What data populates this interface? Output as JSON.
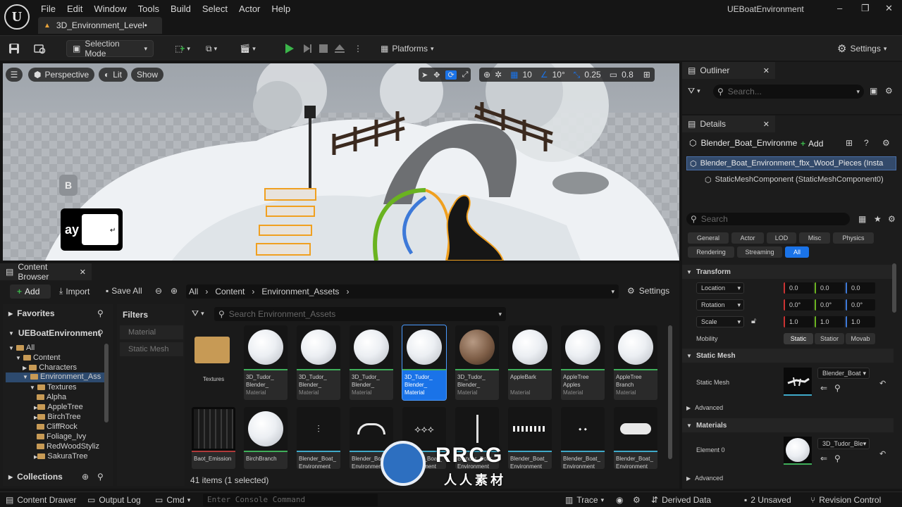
{
  "app_title": "UEBoatEnvironment",
  "menu": [
    "File",
    "Edit",
    "Window",
    "Tools",
    "Build",
    "Select",
    "Actor",
    "Help"
  ],
  "level_tab": "3D_Environment_Level•",
  "toolbar": {
    "selection_mode": "Selection Mode",
    "platforms": "Platforms",
    "settings": "Settings"
  },
  "viewport": {
    "perspective": "Perspective",
    "lit": "Lit",
    "show": "Show",
    "grid_snap": "10",
    "rot_snap": "10°",
    "scale_snap": "0.25",
    "cam_speed": "0.8",
    "key_b": "B",
    "key_text": "ay"
  },
  "outliner": {
    "title": "Outliner",
    "search_placeholder": "Search..."
  },
  "details": {
    "title": "Details",
    "actor_name": "Blender_Boat_Environme",
    "add_label": "Add",
    "selected_row": "Blender_Boat_Environment_fbx_Wood_Pieces (Insta",
    "component_row": "StaticMeshComponent (StaticMeshComponent0)",
    "search_placeholder": "Search",
    "categories": [
      "General",
      "Actor",
      "LOD",
      "Misc",
      "Physics",
      "Rendering",
      "Streaming",
      "All"
    ],
    "transform_section": "Transform",
    "location": {
      "label": "Location",
      "x": "0.0",
      "y": "0.0",
      "z": "0.0"
    },
    "rotation": {
      "label": "Rotation",
      "x": "0.0°",
      "y": "0.0°",
      "z": "0.0°"
    },
    "scale": {
      "label": "Scale",
      "x": "1.0",
      "y": "1.0",
      "z": "1.0"
    },
    "mobility": {
      "label": "Mobility",
      "options": [
        "Static",
        "Statior",
        "Movab"
      ]
    },
    "static_mesh_section": "Static Mesh",
    "static_mesh_label": "Static Mesh",
    "static_mesh_value": "Blender_Boat",
    "advanced": "Advanced",
    "materials_section": "Materials",
    "element0_label": "Element 0",
    "element0_value": "3D_Tudor_Ble",
    "advanced2": "Advanced"
  },
  "content_browser": {
    "title": "Content Browser",
    "add": "Add",
    "import": "Import",
    "save_all": "Save All",
    "breadcrumb": [
      "All",
      "Content",
      "Environment_Assets"
    ],
    "settings": "Settings",
    "favorites": "Favorites",
    "project": "UEBoatEnvironment",
    "tree": [
      {
        "label": "All",
        "depth": 0
      },
      {
        "label": "Content",
        "depth": 1
      },
      {
        "label": "Characters",
        "depth": 2
      },
      {
        "label": "Environment_Ass",
        "depth": 2
      },
      {
        "label": "Textures",
        "depth": 3
      },
      {
        "label": "Alpha",
        "depth": 4
      },
      {
        "label": "AppleTree",
        "depth": 4
      },
      {
        "label": "BirchTree",
        "depth": 4
      },
      {
        "label": "CliffRock",
        "depth": 4
      },
      {
        "label": "Foliage_Ivy",
        "depth": 4
      },
      {
        "label": "RedWoodStyliz",
        "depth": 4
      },
      {
        "label": "SakuraTree",
        "depth": 4
      }
    ],
    "collections": "Collections",
    "filters": "Filters",
    "filter_items": [
      "Material",
      "Static Mesh"
    ],
    "search_placeholder": "Search Environment_Assets",
    "item_count": "41 items (1 selected)",
    "assets_row1": [
      {
        "name": "Textures",
        "type": ""
      },
      {
        "name": "3D_Tudor_ Blender_",
        "type": "Material"
      },
      {
        "name": "3D_Tudor_ Blender_",
        "type": "Material"
      },
      {
        "name": "3D_Tudor_ Blender_",
        "type": "Material"
      },
      {
        "name": "3D_Tudor_ Blender_",
        "type": "Material"
      },
      {
        "name": "3D_Tudor_ Blender_",
        "type": "Material"
      },
      {
        "name": "AppleBark",
        "type": "Material"
      },
      {
        "name": "AppleTree Apples",
        "type": "Material"
      },
      {
        "name": "AppleTree Branch",
        "type": "Material"
      }
    ],
    "assets_row2": [
      {
        "name": "Baot_Emission"
      },
      {
        "name": "BirchBranch"
      },
      {
        "name": "Blender_Boat_ Environment"
      },
      {
        "name": "Blender_Boat_ Environment"
      },
      {
        "name": "Blender_Boat_ Environment"
      },
      {
        "name": "Blender_Boat_ Environment"
      },
      {
        "name": "Blender_Boat_ Environment"
      },
      {
        "name": "Blender_Boat_ Environment"
      },
      {
        "name": "Blender_Boat_ Environment"
      }
    ]
  },
  "statusbar": {
    "content_drawer": "Content Drawer",
    "output_log": "Output Log",
    "cmd": "Cmd",
    "console_placeholder": "Enter Console Command",
    "trace": "Trace",
    "derived_data": "Derived Data",
    "unsaved": "2 Unsaved",
    "revision_control": "Revision Control"
  },
  "watermark": {
    "logo_text": "RRCG",
    "sub_text": "人人素材"
  },
  "colors": {
    "accent_blue": "#1a73e8",
    "play_green": "#3bb54a",
    "material_green": "#3fae5a"
  }
}
